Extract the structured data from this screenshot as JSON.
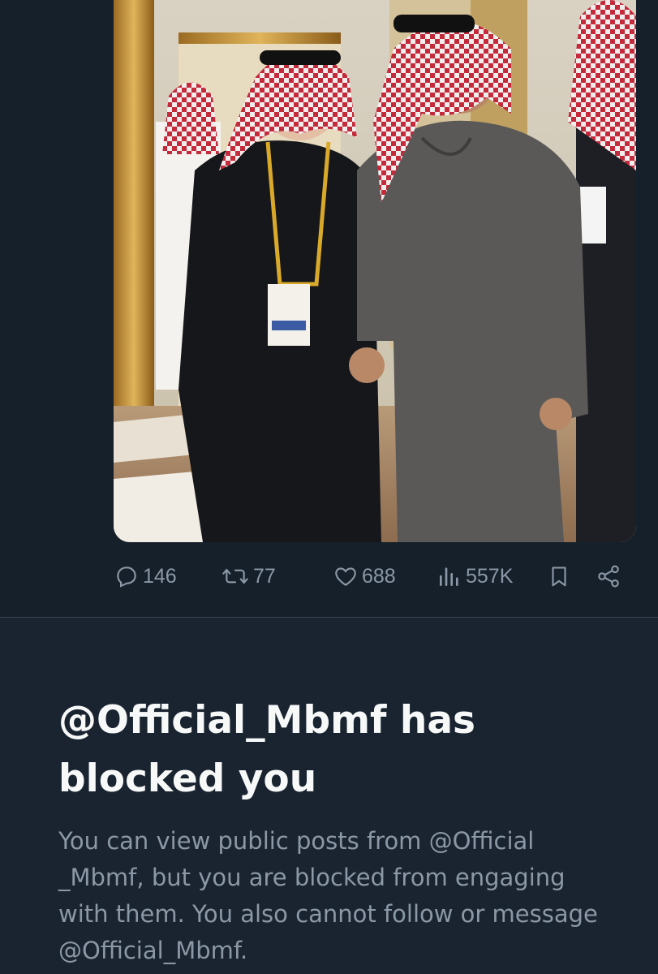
{
  "tweet": {
    "media_alt": "Photo of two men in traditional Saudi attire",
    "actions": {
      "replies": "146",
      "reposts": "77",
      "likes": "688",
      "views": "557K"
    }
  },
  "blocked": {
    "title": "@Official_Mbmf has blocked you",
    "body": "You can view public posts from @Official _Mbmf, but you are blocked from engaging with them. You also cannot follow or message @Official_Mbmf."
  },
  "colors": {
    "background": "#15202b",
    "text_primary": "#f7f9f9",
    "text_secondary": "#8b98a5"
  },
  "icons": [
    "reply-icon",
    "repost-icon",
    "like-icon",
    "views-icon",
    "bookmark-icon",
    "share-icon"
  ]
}
